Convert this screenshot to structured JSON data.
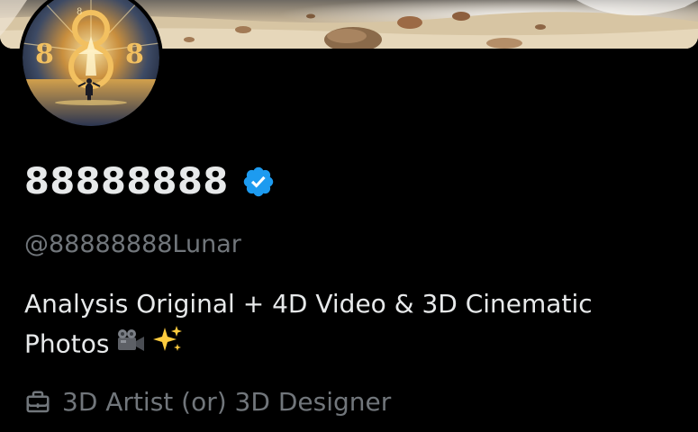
{
  "profile": {
    "display_name": "88888888",
    "verified": true,
    "handle": "@88888888Lunar",
    "bio_line1": "Analysis Original + 4D Video & 3D Cinematic",
    "bio_line2": "Photos",
    "bio_emojis": [
      "movie-camera-icon",
      "sparkles-icon"
    ],
    "profession": "3D Artist (or) 3D Designer",
    "avatar_numerals": [
      "8",
      "8",
      "8",
      "8"
    ]
  },
  "icons": {
    "verified": "verified-badge-icon",
    "profession": "briefcase-icon"
  },
  "colors": {
    "background": "#000000",
    "primary_text": "#e7e9ea",
    "secondary_text": "#71767b",
    "verified_blue": "#1d9bf0",
    "gold": "#e8b44a"
  }
}
